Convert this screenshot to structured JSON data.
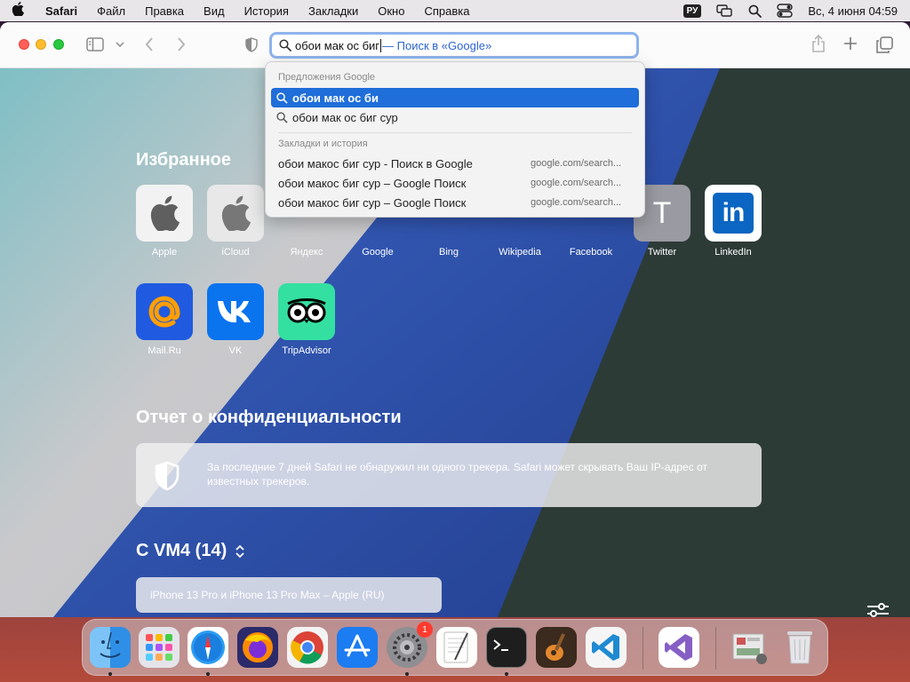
{
  "menubar": {
    "app_name": "Safari",
    "items": [
      "Файл",
      "Правка",
      "Вид",
      "История",
      "Закладки",
      "Окно",
      "Справка"
    ],
    "input_source": "РУ",
    "clock": "Вс, 4 июня  04:59"
  },
  "toolbar": {
    "address_typed": "обои мак ос биг",
    "address_suggestion": "— Поиск в «Google»"
  },
  "dropdown": {
    "google_header": "Предложения Google",
    "suggestions": [
      "обои мак ос би",
      "обои мак ос биг сур"
    ],
    "history_header": "Закладки и история",
    "history": [
      {
        "title": "обои макос биг сур - Поиск в Google",
        "url": "google.com/search..."
      },
      {
        "title": "обои макос биг сур – Google Поиск",
        "url": "google.com/search..."
      },
      {
        "title": "обои макос биг сур – Google Поиск",
        "url": "google.com/search..."
      }
    ]
  },
  "favorites": {
    "title": "Избранное",
    "items": [
      {
        "label": "Apple",
        "icon": "apple-logo"
      },
      {
        "label": "iCloud",
        "icon": "apple-logo"
      },
      {
        "label": "Яндекс",
        "icon": "yandex"
      },
      {
        "label": "Google",
        "icon": "google"
      },
      {
        "label": "Bing",
        "icon": "bing"
      },
      {
        "label": "Wikipedia",
        "icon": "wikipedia"
      },
      {
        "label": "Facebook",
        "icon": "facebook"
      },
      {
        "label": "Twitter",
        "icon": "letter-t"
      },
      {
        "label": "LinkedIn",
        "icon": "linkedin"
      },
      {
        "label": "Mail.Ru",
        "icon": "at-sign"
      },
      {
        "label": "VK",
        "icon": "vk"
      },
      {
        "label": "TripAdvisor",
        "icon": "owl"
      }
    ],
    "twitter_letter": "T",
    "linkedin_text": "in"
  },
  "privacy": {
    "title": "Отчет о конфиденциальности",
    "text": "За последние 7 дней Safari не обнаружил ни одного трекера. Safari может скрывать Ваш IP-адрес от известных трекеров."
  },
  "reading_list": {
    "title": "С VM4 (14)",
    "item": "iPhone 13 Pro и iPhone 13 Pro Max – Apple (RU)"
  },
  "dock": {
    "apps": [
      "Finder",
      "Launchpad",
      "Safari",
      "Firefox",
      "Chrome",
      "App Store",
      "System Preferences",
      "TextEdit",
      "Terminal",
      "GarageBand",
      "Visual Studio Code",
      "Visual Studio",
      "Documents",
      "Trash"
    ],
    "settings_badge": "1"
  },
  "colors": {
    "accent": "#1f6ed9",
    "address_focus": "#8eb3ec",
    "suggestion_link": "#2b64d4"
  }
}
